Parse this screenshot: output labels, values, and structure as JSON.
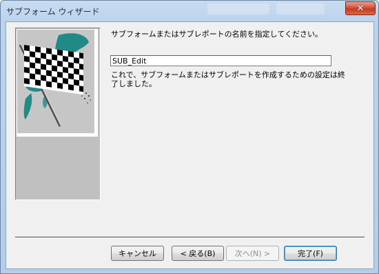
{
  "window": {
    "title": "サブフォーム ウィザード",
    "close_symbol": "✕"
  },
  "wizard": {
    "prompt": "サブフォームまたはサブレポートの名前を指定してください。",
    "name_value": "SUB_Edit",
    "done_text": "これで、サブフォームまたはサブレポートを作成するための設定は終了しました。",
    "image_icon": "checkered-flag"
  },
  "buttons": {
    "cancel": "キャンセル",
    "back": "< 戻る(B)",
    "next": "次へ(N) >",
    "finish": "完了(F)"
  },
  "colors": {
    "flag_teal": "#1f8a86",
    "panel_gray": "#c0c0c0"
  }
}
